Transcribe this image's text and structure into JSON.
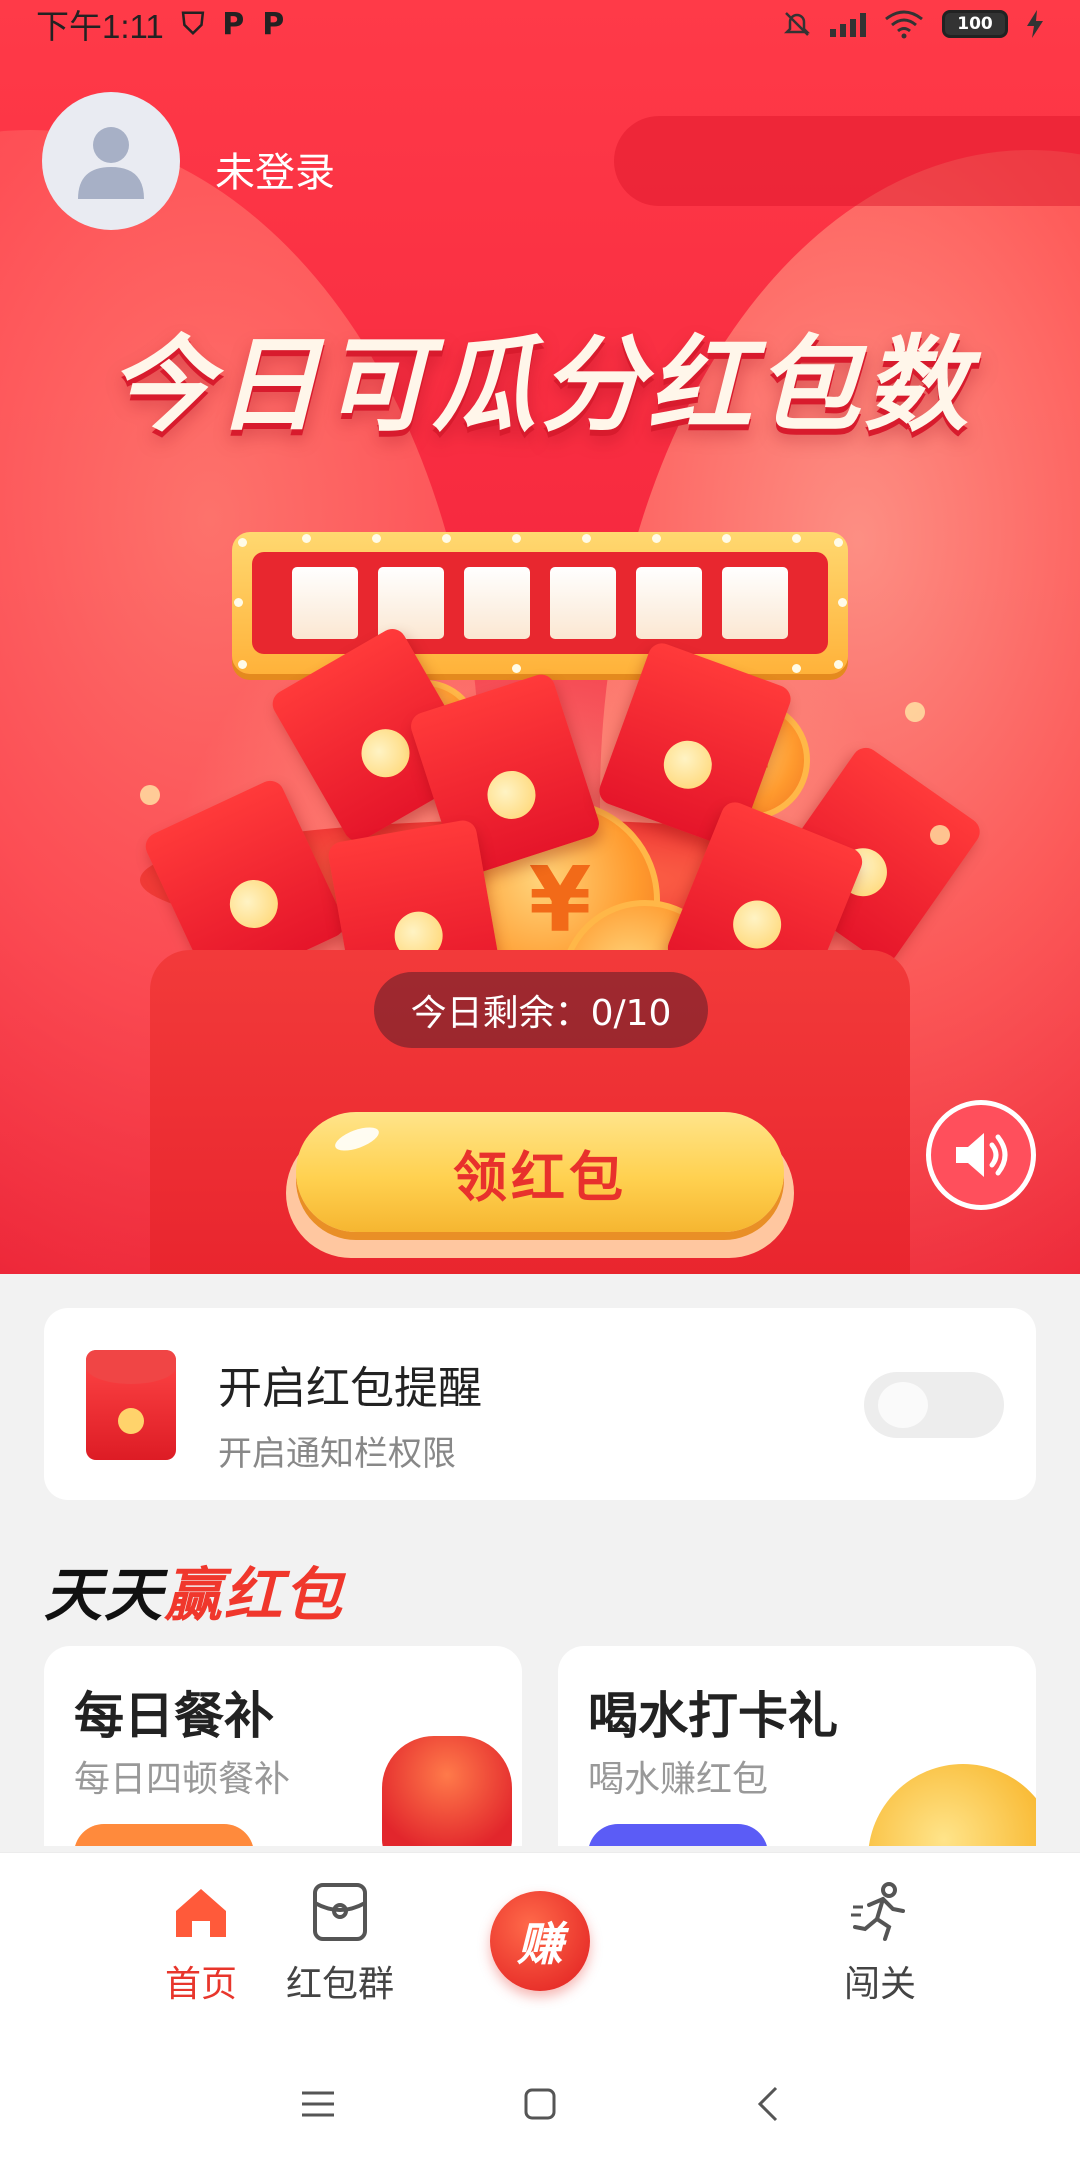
{
  "status_bar": {
    "time": "下午1:11",
    "left_icons": [
      "shield-icon",
      "p-app-icon",
      "p-app-icon"
    ],
    "battery": "100",
    "right_icons": [
      "mute-bell-icon",
      "signal-icon",
      "wifi-icon",
      "battery-icon",
      "charging-icon"
    ]
  },
  "header": {
    "login_text": "未登录",
    "avatar_icon": "user-icon"
  },
  "hero": {
    "title": "今日可瓜分红包数",
    "counter_digits": 6,
    "remaining_label": "今日剩余：0/10",
    "grab_button": "领红包",
    "sound_icon": "speaker-icon"
  },
  "reminder": {
    "title": "开启红包提醒",
    "subtitle": "开启通知栏权限",
    "toggle_on": false
  },
  "section": {
    "title_part1": "天天",
    "title_part2": "赢红包"
  },
  "cards": [
    {
      "title": "每日餐补",
      "subtitle": "每日四顿餐补"
    },
    {
      "title": "喝水打卡礼",
      "subtitle": "喝水赚红包"
    }
  ],
  "bottom_nav": {
    "items": [
      {
        "label": "首页",
        "icon": "home-icon",
        "active": true
      },
      {
        "label": "红包群",
        "icon": "red-packet-group-icon",
        "active": false
      },
      {
        "label": "赚",
        "icon": "earn-icon",
        "active": false
      },
      {
        "label": "闯关",
        "icon": "running-icon",
        "active": false
      }
    ]
  },
  "colors": {
    "hero_red": "#f4253d",
    "accent_orange": "#ff8a3c",
    "accent_yellow": "#ffd150",
    "active_nav": "#e8362c"
  }
}
